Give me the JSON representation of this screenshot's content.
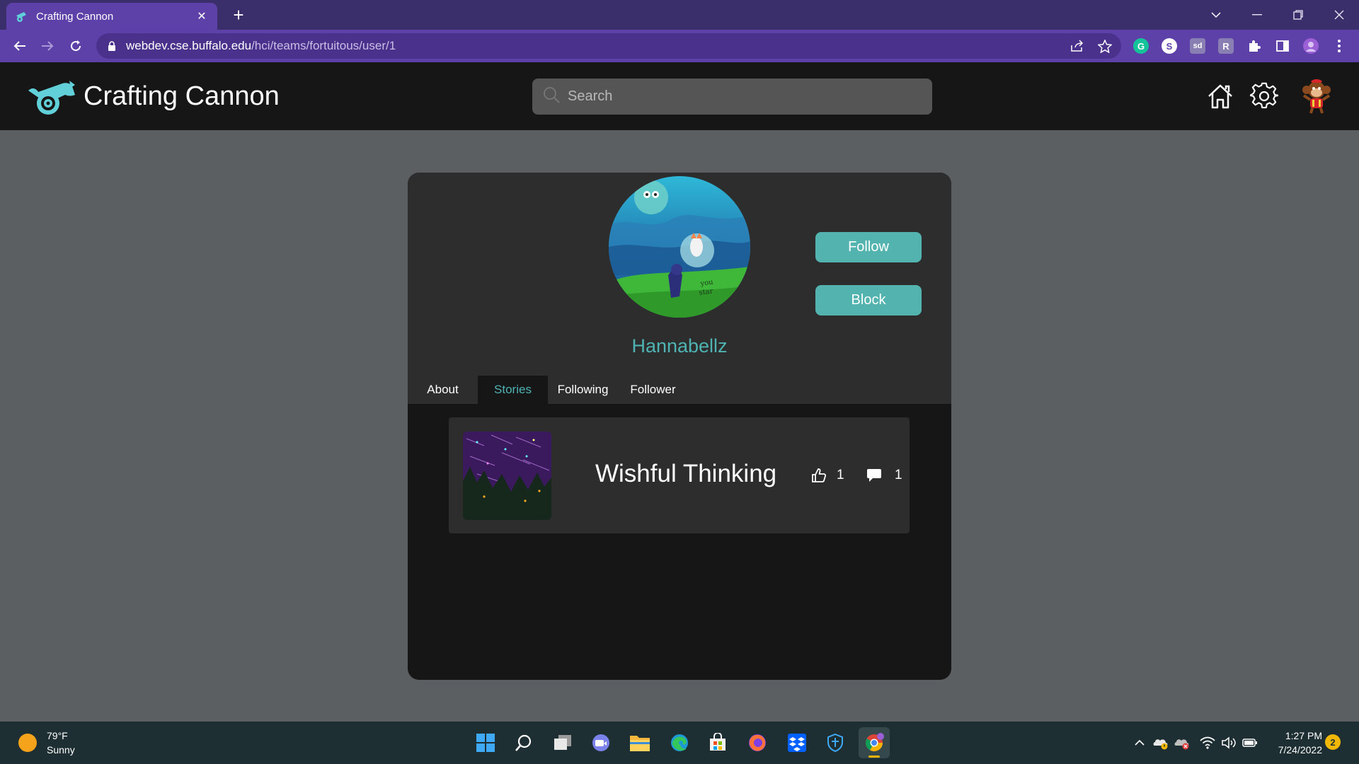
{
  "browser": {
    "tab_title": "Crafting Cannon",
    "new_tab_label": "+",
    "url_host": "webdev.cse.buffalo.edu",
    "url_path": "/hci/teams/fortuitous/user/1",
    "extensions": [
      "G",
      "S",
      "sd",
      "R"
    ]
  },
  "site": {
    "brand": "Crafting Cannon",
    "search_placeholder": "Search",
    "accent_color": "#52b3af"
  },
  "profile": {
    "username": "Hannabellz",
    "follow_label": "Follow",
    "block_label": "Block",
    "tabs": [
      {
        "label": "About",
        "active": false
      },
      {
        "label": "Stories",
        "active": true
      },
      {
        "label": "Following",
        "active": false
      },
      {
        "label": "Follower",
        "active": false
      }
    ]
  },
  "stories": [
    {
      "title": "Wishful Thinking",
      "likes": "1",
      "comments": "1"
    }
  ],
  "taskbar": {
    "temperature": "79°F",
    "condition": "Sunny",
    "time": "1:27 PM",
    "date": "7/24/2022",
    "notifications": "2"
  }
}
